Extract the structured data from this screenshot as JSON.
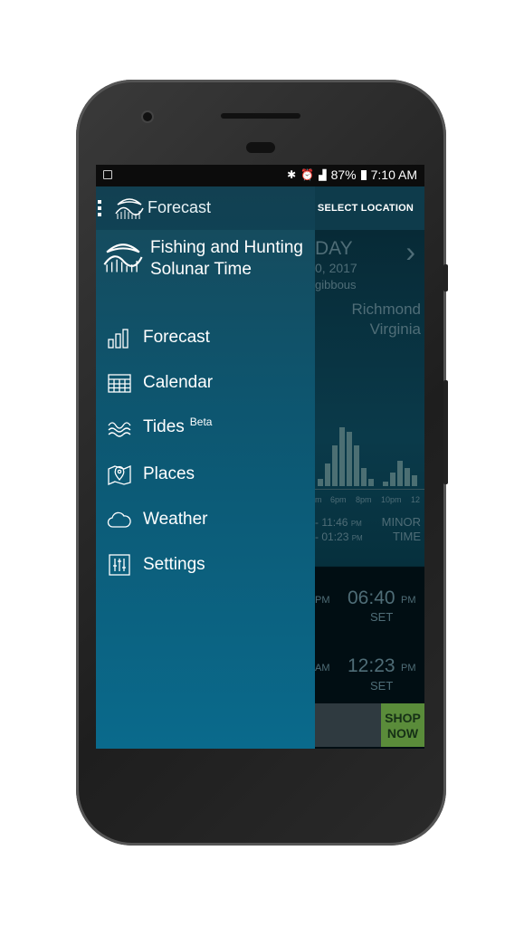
{
  "status_bar": {
    "battery": "87%",
    "time": "7:10 AM"
  },
  "app_bar": {
    "title": "Forecast",
    "select_location": "SELECT LOCATION"
  },
  "drawer": {
    "header_line1": "Fishing and Hunting",
    "header_line2": "Solunar Time",
    "items": [
      {
        "label": "Forecast",
        "icon": "bar-chart-icon"
      },
      {
        "label": "Calendar",
        "icon": "calendar-icon"
      },
      {
        "label": "Tides",
        "badge": "Beta",
        "icon": "waves-icon"
      },
      {
        "label": "Places",
        "icon": "map-pin-icon"
      },
      {
        "label": "Weather",
        "icon": "cloud-icon"
      },
      {
        "label": "Settings",
        "icon": "sliders-icon"
      }
    ]
  },
  "background": {
    "day": "DAY",
    "date": "0, 2017",
    "moon": "gibbous",
    "city": "Richmond",
    "state": "Virginia",
    "x_ticks": [
      "m",
      "6pm",
      "8pm",
      "10pm",
      "12"
    ],
    "activity_bars": [
      8,
      25,
      45,
      65,
      60,
      45,
      20,
      8,
      0,
      5,
      15,
      28,
      20,
      12
    ],
    "minor_time_1": "11:46",
    "minor_time_2": "01:23",
    "pm": "PM",
    "am": "AM",
    "minor_label1": "MINOR",
    "minor_label2": "TIME",
    "set_time_1": "06:40",
    "set_time_2": "12:23",
    "set_label": "SET",
    "ad_text1": "SHOP",
    "ad_text2": "NOW"
  },
  "colors": {
    "drawer_top": "#17495a",
    "drawer_bottom": "#0a6a8c",
    "app_bar": "#0e3b4b"
  }
}
